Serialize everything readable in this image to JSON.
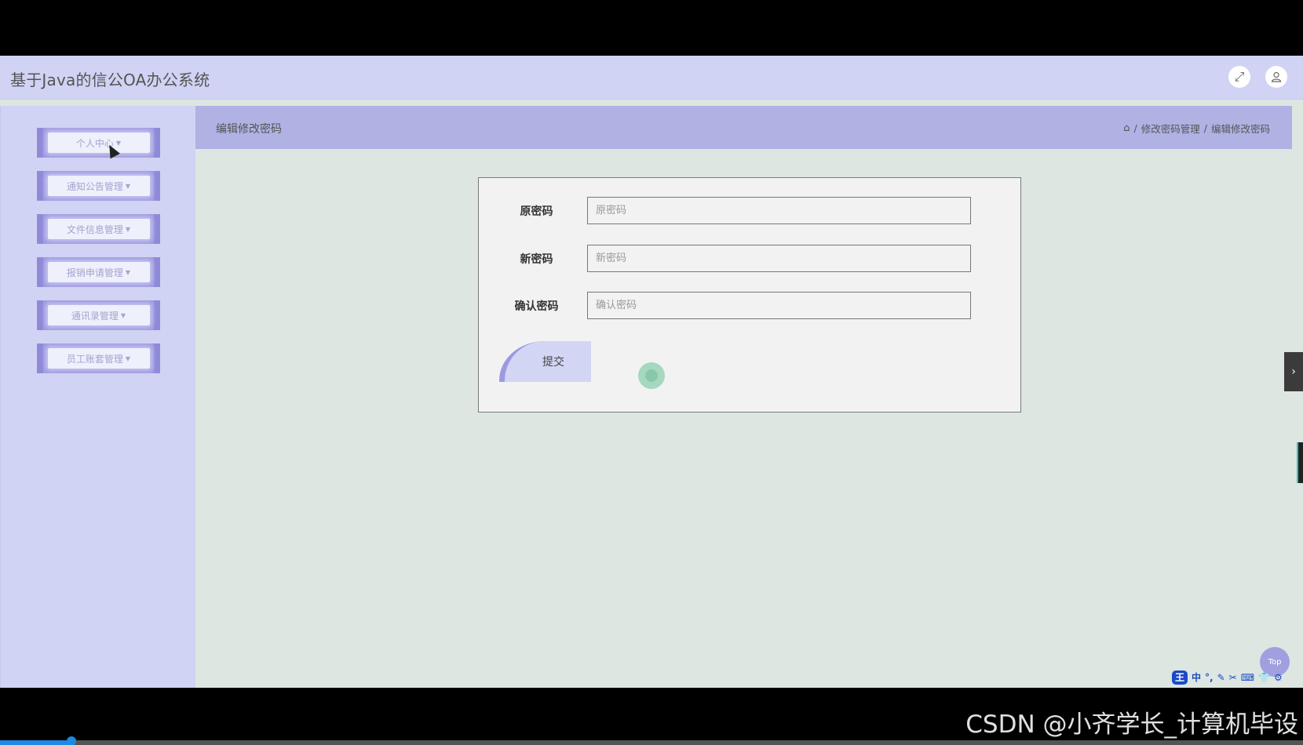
{
  "app": {
    "title": "基于Java的信公OA办公系统",
    "icons": {
      "fullscreen": "expand-icon",
      "user": "user-icon"
    }
  },
  "sidebar": {
    "items": [
      {
        "label": "个人中心"
      },
      {
        "label": "通知公告管理"
      },
      {
        "label": "文件信息管理"
      },
      {
        "label": "报销申请管理"
      },
      {
        "label": "通讯录管理"
      },
      {
        "label": "员工账套管理"
      }
    ]
  },
  "header": {
    "page_title": "编辑修改密码",
    "breadcrumb": [
      "修改密码管理",
      "编辑修改密码"
    ],
    "separator": "/"
  },
  "form": {
    "fields": [
      {
        "label": "原密码",
        "placeholder": "原密码",
        "value": ""
      },
      {
        "label": "新密码",
        "placeholder": "新密码",
        "value": ""
      },
      {
        "label": "确认密码",
        "placeholder": "确认密码",
        "value": ""
      }
    ],
    "submit_label": "提交"
  },
  "widgets": {
    "top_label": "Top",
    "ime": [
      "王",
      "中",
      "°,",
      "✎",
      "✂",
      "⌨",
      "👕",
      "⚙"
    ]
  },
  "overlay": {
    "watermark": "CSDN @小齐学长_计算机毕设",
    "video_progress": 0.055
  },
  "colors": {
    "topbar": "#d0d3f3",
    "header_bar": "#afb2e3",
    "accent": "#9d9ae0",
    "content_bg": "#dde6e1"
  }
}
